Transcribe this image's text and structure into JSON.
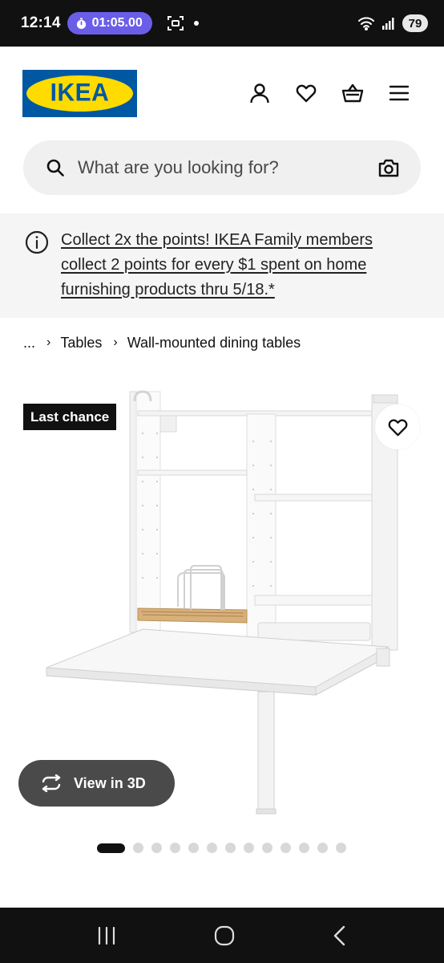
{
  "status_bar": {
    "time": "12:14",
    "timer": "01:05.00",
    "battery": "79"
  },
  "header": {
    "logo_text": "IKEA",
    "icons": [
      "profile-icon",
      "heart-icon",
      "basket-icon",
      "menu-icon"
    ]
  },
  "search": {
    "placeholder": "What are you looking for?"
  },
  "promo": {
    "text": "Collect 2x the points! IKEA Family members collect 2 points for every $1 spent on home furnishing products thru 5/18.*"
  },
  "breadcrumb": {
    "ellipsis": "...",
    "items": [
      "Tables",
      "Wall-mounted dining tables"
    ]
  },
  "product": {
    "badge": "Last chance",
    "view3d_label": "View in 3D",
    "image_count": 14,
    "active_image": 1
  },
  "colors": {
    "ikea_blue": "#0058a3",
    "ikea_yellow": "#ffdb00",
    "timer_purple": "#6a5ee8"
  }
}
